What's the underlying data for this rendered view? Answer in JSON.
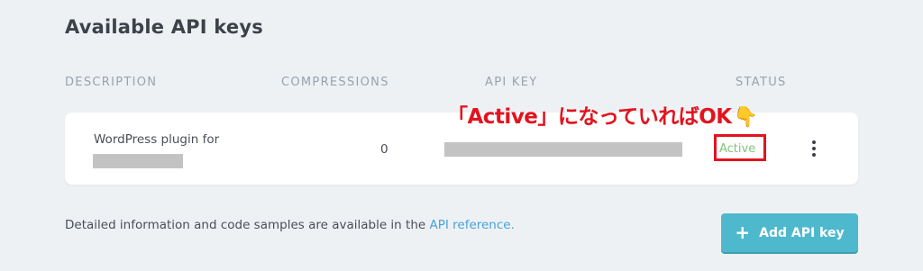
{
  "section": {
    "title": "Available API keys"
  },
  "table": {
    "headers": {
      "description": "DESCRIPTION",
      "compressions": "COMPRESSIONS",
      "api_key": "API KEY",
      "status": "STATUS"
    },
    "rows": [
      {
        "description": "WordPress plugin for",
        "compressions": "0",
        "status": "Active"
      }
    ]
  },
  "annotation": {
    "text": "「Active」になっていればOK",
    "icon": "pointing-down-hand-icon",
    "icon_glyph": "👇",
    "color": "#e3131e"
  },
  "footer": {
    "text": "Detailed information and code samples are available in the ",
    "link_text": "API reference.",
    "add_button_label": "Add API key",
    "add_button_icon": "+"
  },
  "colors": {
    "accent": "#4eb9cd",
    "link": "#46a3d8",
    "status_active": "#82c47a"
  }
}
